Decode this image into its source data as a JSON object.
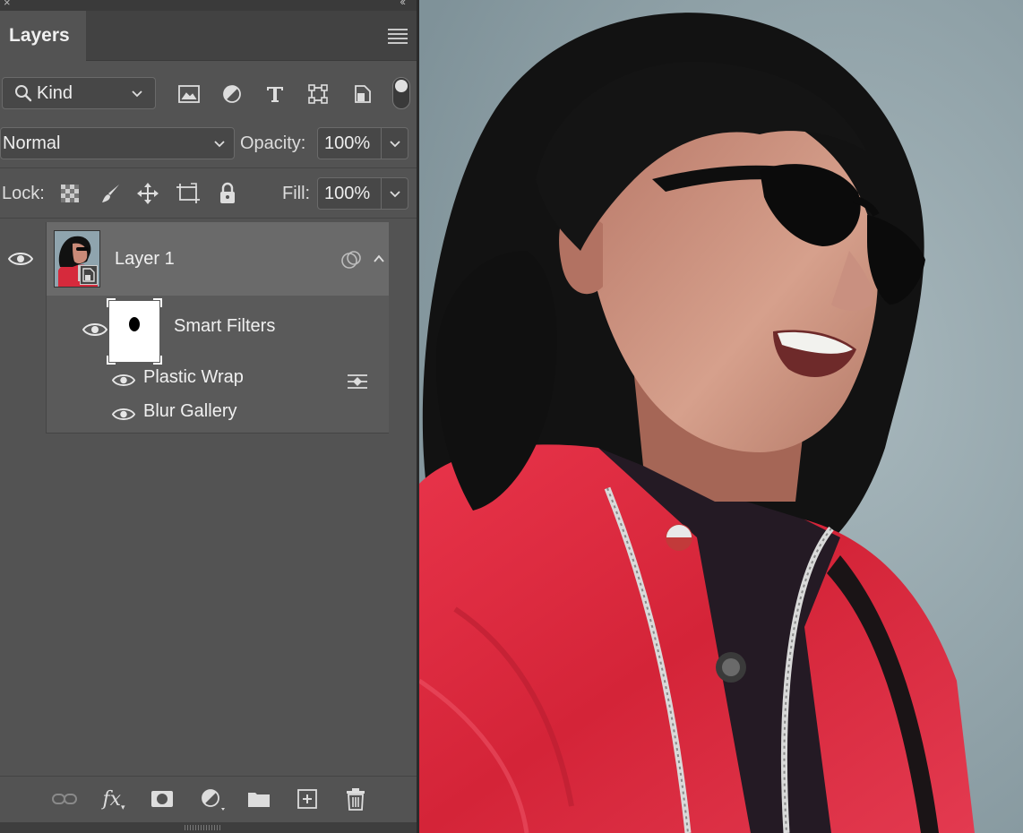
{
  "panel": {
    "tab_label": "Layers",
    "filter": {
      "label": "Kind"
    },
    "blend": {
      "mode": "Normal",
      "opacity_label": "Opacity:",
      "opacity": "100%"
    },
    "lock": {
      "label": "Lock:",
      "fill_label": "Fill:",
      "fill": "100%"
    }
  },
  "layers": [
    {
      "name": "Layer 1",
      "smart_filters": {
        "label": "Smart Filters",
        "items": [
          {
            "name": "Plastic Wrap"
          },
          {
            "name": "Blur Gallery"
          }
        ]
      }
    }
  ],
  "colors": {
    "panel_bg": "#535353",
    "selected_layer_bg": "#6a6a6a",
    "jacket_red": "#e0283c",
    "wall": "#93a5ab"
  }
}
